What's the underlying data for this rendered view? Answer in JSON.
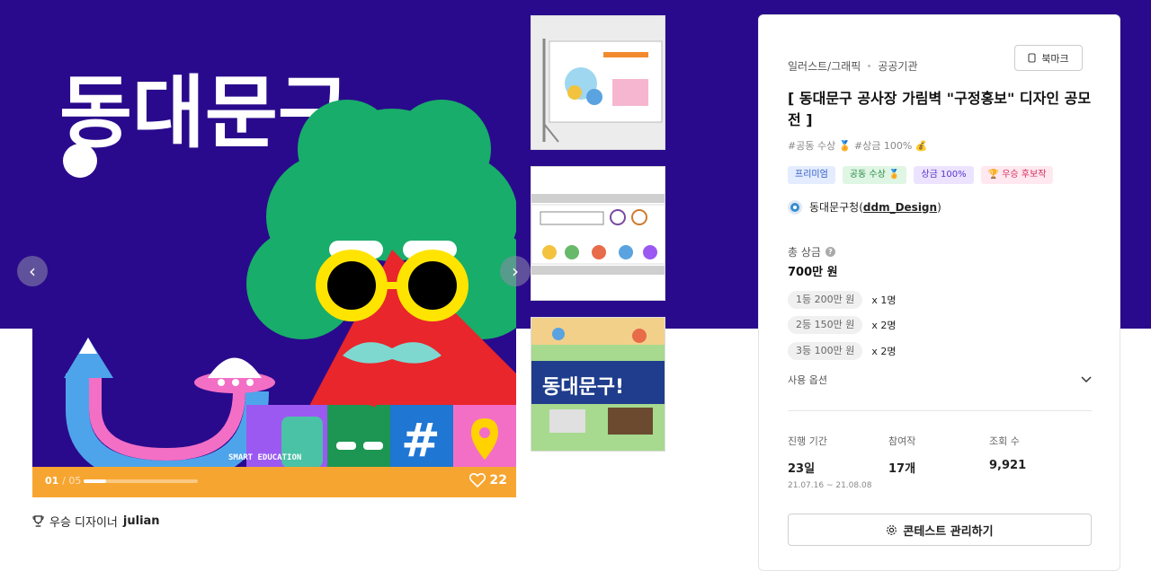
{
  "gallery": {
    "poster_title": "동대문구",
    "poster_caption": "SMART EDUCATION",
    "counter_current": "01",
    "counter_total": "05",
    "progress": 0.2,
    "likes": "22",
    "winner_label": "우승 디자이너",
    "winner_name": "julian"
  },
  "contest": {
    "category": "일러스트/그래픽",
    "subcategory": "공공기관",
    "bookmark_label": "북마크",
    "title": "[ 동대문구 공사장 가림벽 \"구정홍보\" 디자인 공모전 ]",
    "tags": "#공동 수상 🏅 #상금 100% 💰",
    "badges": [
      "프리미엄",
      "공동 수상 🏅",
      "상금 100%",
      "🏆 우승 후보작"
    ],
    "host_name": "동대문구청",
    "host_id": "ddm_Design",
    "prize_label": "총 상금",
    "prize_help": "?",
    "prize_total": "700만 원",
    "tiers": [
      {
        "label": "1등 200만 원",
        "count": "x 1명"
      },
      {
        "label": "2등 150만 원",
        "count": "x 2명"
      },
      {
        "label": "3등 100만 원",
        "count": "x 2명"
      }
    ],
    "options_label": "사용 옵션",
    "stats": {
      "period_label": "진행 기간",
      "period_value": "23일",
      "period_range": "21.07.16 ~ 21.08.08",
      "entries_label": "참여작",
      "entries_value": "17개",
      "views_label": "조회 수",
      "views_value": "9,921"
    },
    "manage_label": "콘테스트 관리하기"
  },
  "colors": {
    "band": "#2a0a8c",
    "accent_orange": "#f7a531"
  }
}
